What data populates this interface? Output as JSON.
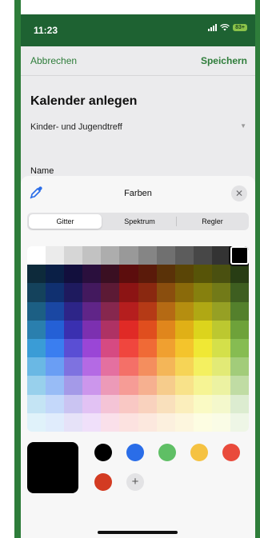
{
  "status_bar": {
    "time": "11:23",
    "battery": "83+"
  },
  "nav": {
    "cancel_label": "Abbrechen",
    "save_label": "Speichern"
  },
  "form": {
    "title": "Kalender anlegen",
    "group_value": "Kinder- und Jugendtreff",
    "name_label": "Name"
  },
  "sheet": {
    "title": "Farben",
    "close_symbol": "✕",
    "tabs": [
      {
        "label": "Gitter",
        "active": true
      },
      {
        "label": "Spektrum",
        "active": false
      },
      {
        "label": "Regler",
        "active": false
      }
    ],
    "add_symbol": "+"
  },
  "colors": {
    "accent": "#2e7d3a",
    "status_bar_bg": "#1e6232",
    "selected_color": "#000000"
  },
  "icons": {
    "pipette": "eyedropper-icon",
    "close": "close-icon",
    "add": "plus-icon"
  },
  "color_grid": {
    "selected": {
      "row": 0,
      "col": 11
    },
    "rows": [
      [
        "#ffffff",
        "#ebebeb",
        "#d6d6d6",
        "#c2c2c2",
        "#adadad",
        "#999999",
        "#858585",
        "#707070",
        "#5c5c5c",
        "#474747",
        "#333333",
        "#000000"
      ],
      [
        "#0d2a3b",
        "#0a1f46",
        "#120f3d",
        "#2a0f3d",
        "#3a0f22",
        "#5c0d0d",
        "#5a1a0a",
        "#5a3208",
        "#5a4506",
        "#575408",
        "#4a5010",
        "#283d14"
      ],
      [
        "#14425c",
        "#103070",
        "#1e1a5e",
        "#43195e",
        "#5c1a35",
        "#8c1414",
        "#8a2810",
        "#8a4e0e",
        "#8a6a0a",
        "#86800e",
        "#727a18",
        "#3e5e20"
      ],
      [
        "#1c5f84",
        "#1a47a3",
        "#2d2588",
        "#602588",
        "#86274e",
        "#b51e1e",
        "#b53a16",
        "#b56a14",
        "#b58e10",
        "#b0a814",
        "#96a024",
        "#54802c"
      ],
      [
        "#2a7fae",
        "#2460d6",
        "#3a30b0",
        "#7c30b0",
        "#ae3264",
        "#e02a26",
        "#e04e1e",
        "#e0861c",
        "#e0b016",
        "#dcd41c",
        "#bcc830",
        "#6ea23a"
      ],
      [
        "#3a9cd6",
        "#3a7ef0",
        "#5a4ed4",
        "#9a46d6",
        "#d64a82",
        "#f0463e",
        "#f06a36",
        "#f0a030",
        "#f4c42c",
        "#f0e834",
        "#d4e04a",
        "#86bc52"
      ],
      [
        "#6ab8e4",
        "#6a9ef4",
        "#7e72e0",
        "#b46ae4",
        "#e470a0",
        "#f47068",
        "#f48e5e",
        "#f4b658",
        "#f6d456",
        "#f4f060",
        "#e2ea76",
        "#a2cc7a"
      ],
      [
        "#98d0ec",
        "#98bcf6",
        "#a49ae8",
        "#cc96ec",
        "#ec9ab8",
        "#f69c96",
        "#f6b090",
        "#f6cc8c",
        "#f8e28a",
        "#f6f494",
        "#ecf2a2",
        "#c0dca4"
      ],
      [
        "#c4e4f4",
        "#c4d8fa",
        "#cac4f2",
        "#e2c2f4",
        "#f4c4d6",
        "#f9c8c4",
        "#f9d2be",
        "#f9e0bc",
        "#fbeebc",
        "#fafac4",
        "#f4f8cc",
        "#dcecd0"
      ],
      [
        "#e0f2fa",
        "#e0ecfc",
        "#e6e2f8",
        "#f0e0fa",
        "#fae0ea",
        "#fce2e0",
        "#fce8de",
        "#fcf0de",
        "#fdf6de",
        "#fdfde2",
        "#fafce6",
        "#eef6e6"
      ]
    ]
  },
  "saved_colors": [
    "#000000",
    "#2a6de8",
    "#5fbf65",
    "#f5c242",
    "#e94b3c",
    "#d33b22"
  ]
}
